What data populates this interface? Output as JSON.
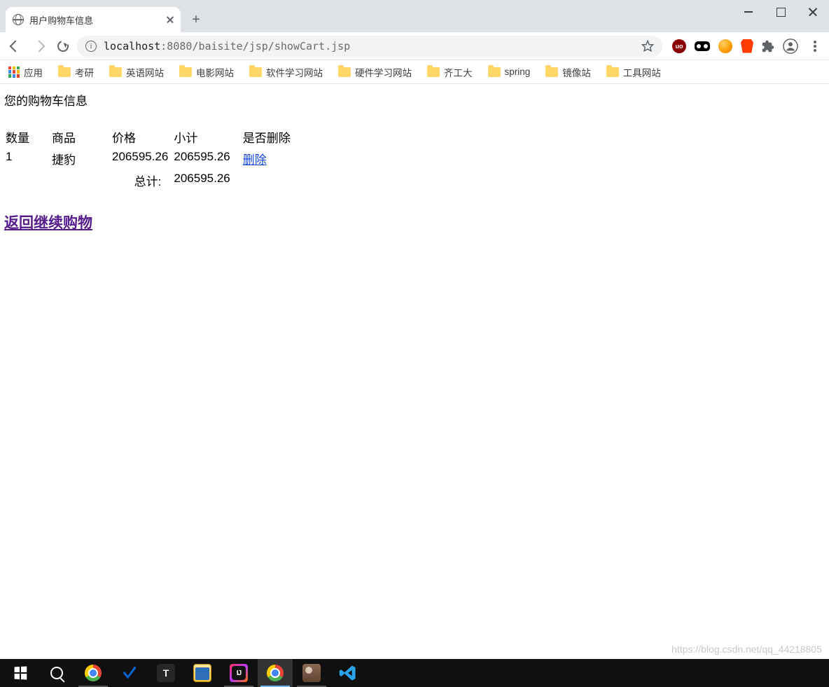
{
  "browser": {
    "tab_title": "用户购物车信息",
    "url_host": "localhost",
    "url_port": ":8080",
    "url_path": "/baisite/jsp/showCart.jsp",
    "newtab_symbol": "+"
  },
  "bookmarks": {
    "apps_label": "应用",
    "items": [
      "考研",
      "英语网站",
      "电影网站",
      "软件学习网站",
      "硬件学习网站",
      "齐工大",
      "spring",
      "镜像站",
      "工具网站"
    ]
  },
  "page": {
    "heading": "您的购物车信息",
    "columns": {
      "qty": "数量",
      "product": "商品",
      "price": "价格",
      "subtotal": "小计",
      "delete": "是否删除"
    },
    "rows": [
      {
        "qty": "1",
        "product": "捷豹",
        "price": "206595.26",
        "subtotal": "206595.26",
        "delete_text": "删除"
      }
    ],
    "total_label": "总计:",
    "total_value": "206595.26",
    "continue_link": "返回继续购物"
  },
  "watermark": "https://blog.csdn.net/qq_44218805"
}
